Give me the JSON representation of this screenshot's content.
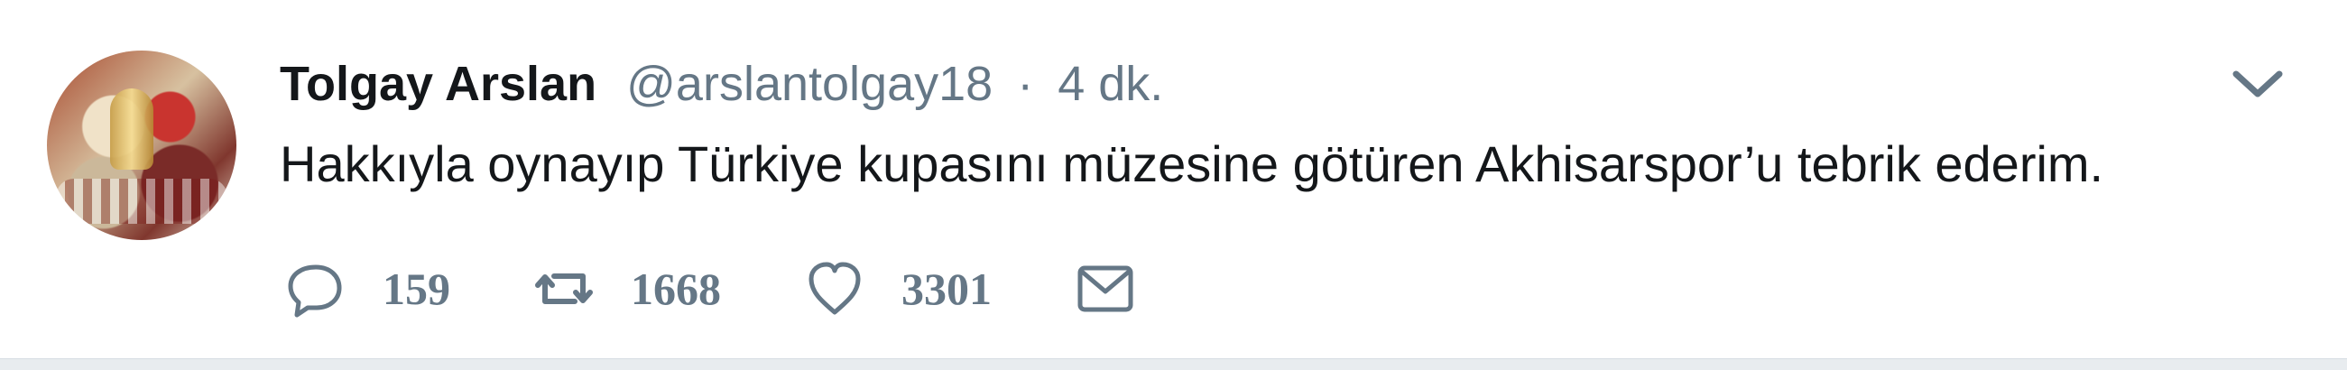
{
  "tweet": {
    "author_name": "Tolgay Arslan",
    "handle": "@arslantolgay18",
    "separator": "·",
    "time": "4 dk.",
    "text": "Hakkıyla oynayıp Türkiye kupasını müzesine götüren Akhisarspor’u tebrik ederim.",
    "actions": {
      "reply": {
        "icon": "reply-icon",
        "count": "159"
      },
      "retweet": {
        "icon": "retweet-icon",
        "count": "1668"
      },
      "like": {
        "icon": "heart-icon",
        "count": "3301"
      },
      "message": {
        "icon": "envelope-icon"
      }
    },
    "menu_icon": "chevron-down-icon"
  },
  "colors": {
    "background": "#ffffff",
    "page": "#e8ecef",
    "text_primary": "#14171a",
    "text_secondary": "#657786"
  }
}
